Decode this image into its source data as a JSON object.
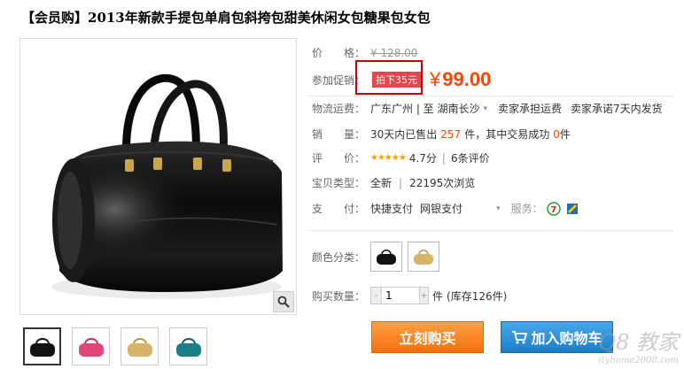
{
  "title": "【会员购】2013年新款手提包单肩包斜挎包甜美休闲女包糖果包女包",
  "price": {
    "label": "价　　格：",
    "original": "¥ 128.00"
  },
  "promo": {
    "label": "参加促销：",
    "tag": "拍下35元",
    "currency": "¥",
    "amount": "99.00"
  },
  "shipping": {
    "label": "物流运费：",
    "route": "广东广州 | 至 湖南长沙",
    "fee": "卖家承担运费",
    "promise": "卖家承诺7天内发货"
  },
  "sales": {
    "label": "销　　量：",
    "prefix": "30天内已售出",
    "count": "257",
    "mid": "件，其中交易成功",
    "success": "0",
    "suffix": "件"
  },
  "rating": {
    "label": "评　　价：",
    "stars": "★★★★★",
    "score": "4.7分",
    "divider": "|",
    "reviews": "6条评价"
  },
  "item_type": {
    "label": "宝贝类型：",
    "type": "全新",
    "divider": "|",
    "views": "22195次浏览"
  },
  "payment": {
    "label": "支　　付：",
    "method1": "快捷支付",
    "method2": "网银支付",
    "service_label": "服务："
  },
  "color": {
    "label": "颜色分类："
  },
  "quantity": {
    "label": "购买数量：",
    "value": "1",
    "unit": "件",
    "stock": "(库存126件)"
  },
  "buttons": {
    "buy_now": "立刻购买",
    "add_cart": "加入购物车"
  },
  "watermark": {
    "main": "Q8 教家",
    "sub": "ityhome2008.com"
  },
  "colors": {
    "price": "#ff4400",
    "buy": "#f46f0f",
    "cart": "#1a7ec7",
    "highlight_box": "#cc0000"
  },
  "thumbnails": [
    {
      "name": "black",
      "color": "#111111"
    },
    {
      "name": "pink",
      "color": "#e0457b"
    },
    {
      "name": "gold",
      "color": "#d6b46a"
    },
    {
      "name": "teal",
      "color": "#1a7f86"
    }
  ]
}
